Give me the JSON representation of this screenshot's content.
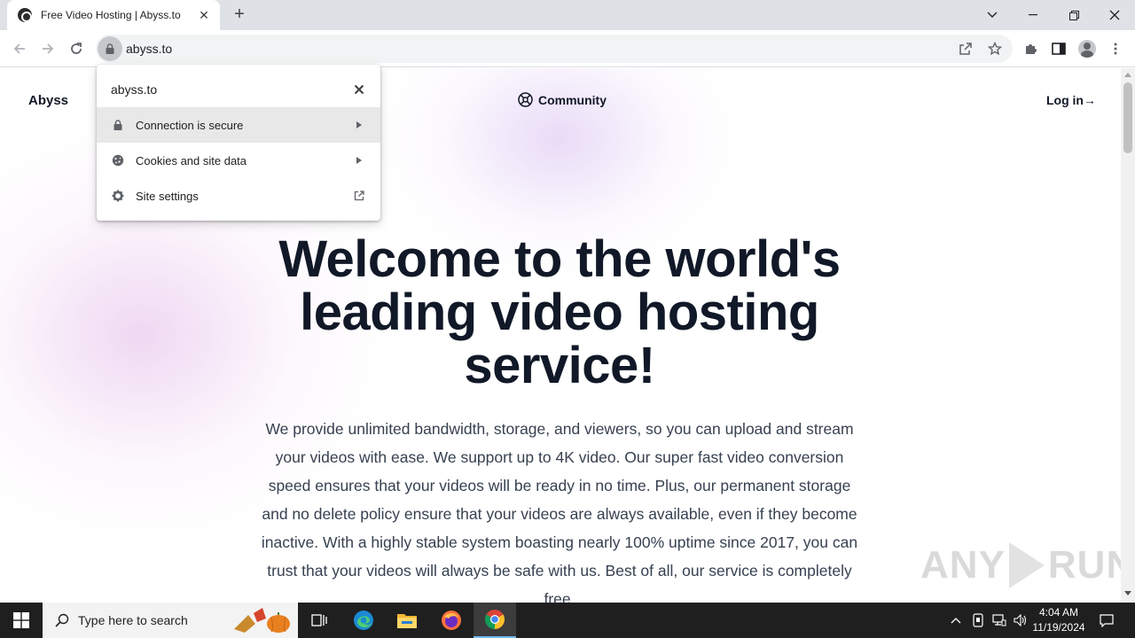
{
  "browser": {
    "tab_title": "Free Video Hosting | Abyss.to",
    "url": "abyss.to"
  },
  "site_info_popup": {
    "host": "abyss.to",
    "items": [
      {
        "label": "Connection is secure",
        "icon": "lock-icon",
        "action": "chevron-right-icon"
      },
      {
        "label": "Cookies and site data",
        "icon": "cookie-icon",
        "action": "chevron-right-icon"
      },
      {
        "label": "Site settings",
        "icon": "gear-icon",
        "action": "external-link-icon"
      }
    ]
  },
  "page": {
    "brand": "Abyss",
    "nav_community": "Community",
    "nav_login": "Log in→",
    "hero_title": "Welcome to the world's leading video hosting service!",
    "lead": "We provide unlimited bandwidth, storage, and viewers, so you can upload and stream your videos with ease. We support up to 4K video. Our super fast video conversion speed ensures that your videos will be ready in no time. Plus, our permanent storage and no delete policy ensure that your videos are always available, even if they become inactive. With a highly stable system boasting nearly 100% uptime since 2017, you can trust that your videos will always be safe with us. Best of all, our service is completely free.",
    "watermark_left": "ANY",
    "watermark_right": "RUN"
  },
  "taskbar": {
    "search_placeholder": "Type here to search",
    "time": "4:04 AM",
    "date": "11/19/2024"
  },
  "colors": {
    "text_dark": "#111827",
    "popup_highlight": "#e8e8e8",
    "taskbar_bg": "#1f1f1f"
  }
}
